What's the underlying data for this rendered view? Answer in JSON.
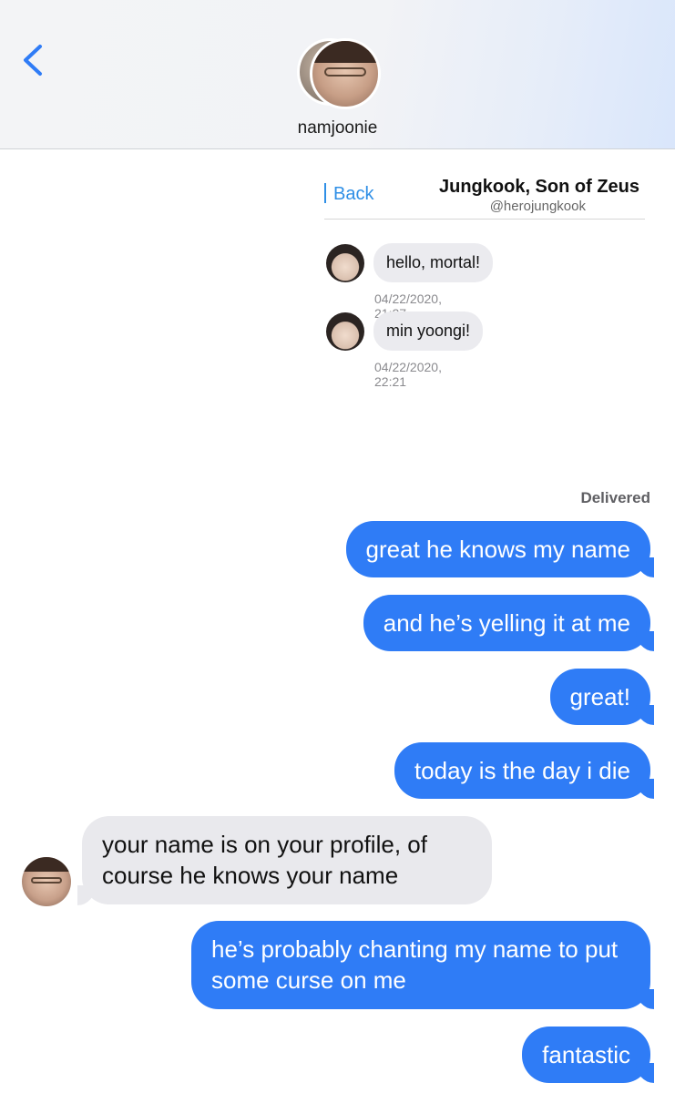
{
  "header": {
    "contact_name": "namjoonie",
    "back_icon": "chevron-left-icon"
  },
  "embedded": {
    "back_label": "Back",
    "title": "Jungkook, Son of Zeus",
    "handle": "@herojungkook",
    "messages": [
      {
        "text": "hello, mortal!",
        "time": "04/22/2020, 21:27"
      },
      {
        "text": "min yoongi!",
        "time": "04/22/2020, 22:21"
      }
    ]
  },
  "conversation": {
    "delivered_label": "Delivered",
    "messages": [
      {
        "side": "out",
        "text": "great he knows my name"
      },
      {
        "side": "out",
        "text": "and he’s yelling it at me"
      },
      {
        "side": "out",
        "text": "great!"
      },
      {
        "side": "out",
        "text": "today is the day i die"
      },
      {
        "side": "in",
        "text": "your name is on your profile, of course he knows your name"
      },
      {
        "side": "out",
        "text": "he’s probably chanting my name to put some curse on me"
      },
      {
        "side": "out",
        "text": "fantastic"
      }
    ]
  },
  "colors": {
    "outgoing_bubble": "#2f7cf6",
    "incoming_bubble": "#e9e9ed",
    "accent": "#2f8fe6"
  }
}
